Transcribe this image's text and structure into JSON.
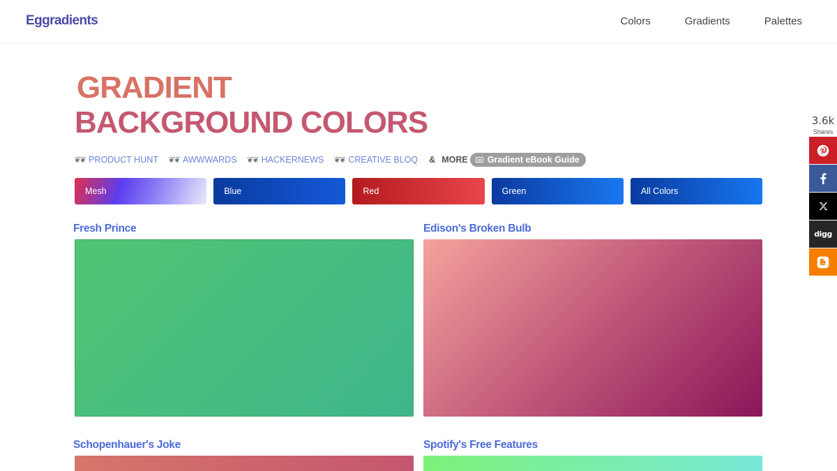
{
  "header": {
    "logo": "Eggradients",
    "nav": [
      "Colors",
      "Gradients",
      "Palettes"
    ]
  },
  "hero": {
    "line1": "GRADIENT",
    "line2": "BACKGROUND COLORS"
  },
  "awards": {
    "items": [
      "PRODUCT HUNT",
      "AWWWARDS",
      "HACKERNEWS",
      "CREATIVE BLOQ"
    ],
    "more_prefix": "&",
    "more_label": "MORE",
    "ebook_label": "Gradient eBook Guide"
  },
  "categories": [
    {
      "label": "Mesh"
    },
    {
      "label": "Blue"
    },
    {
      "label": "Red"
    },
    {
      "label": "Green"
    },
    {
      "label": "All Colors"
    }
  ],
  "gradients": [
    {
      "name": "Fresh Prince",
      "from": "#52c573",
      "to": "#3eb68b"
    },
    {
      "name": "Edison's Broken Bulb",
      "from": "#f5a29c",
      "to": "#8a1659"
    },
    {
      "name": "Schopenhauer's Joke",
      "from": "#d6766a",
      "to": "#c4566f"
    },
    {
      "name": "Spotify's Free Features",
      "from": "#7cf27a",
      "to": "#7ae8d8"
    }
  ],
  "share": {
    "count": "3.6k",
    "label": "Shares",
    "buttons": [
      {
        "icon": "pinterest-icon"
      },
      {
        "icon": "facebook-icon"
      },
      {
        "icon": "x-icon"
      },
      {
        "icon": "digg-icon",
        "text": "digg"
      },
      {
        "icon": "blogger-icon"
      }
    ]
  }
}
